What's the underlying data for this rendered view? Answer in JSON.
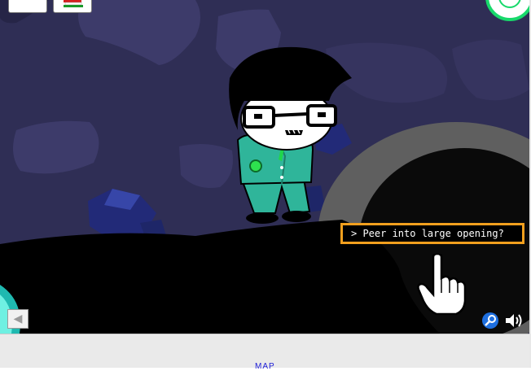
{
  "game": {
    "command_text": "> Peer into large opening?",
    "footer": {
      "map_label": "MAP"
    }
  },
  "colors": {
    "background": "#2f2e55",
    "rock": "#3d3b6a",
    "ground": "#000000",
    "pit_rim": "#5f5f5f",
    "character_suit": "#2fb59a",
    "command_border": "#f2a01e",
    "map_link": "#1c1cd6"
  },
  "icons": {
    "inventory_slot_1": "blank-card-icon",
    "inventory_slot_2": "book-icon",
    "top_right": "green-spirograph-icon",
    "left_portal": "cyan-portal-icon",
    "back": "back-arrow-icon",
    "zoom": "magnifier-icon",
    "sound": "speaker-icon",
    "cursor": "pointer-hand-icon"
  }
}
